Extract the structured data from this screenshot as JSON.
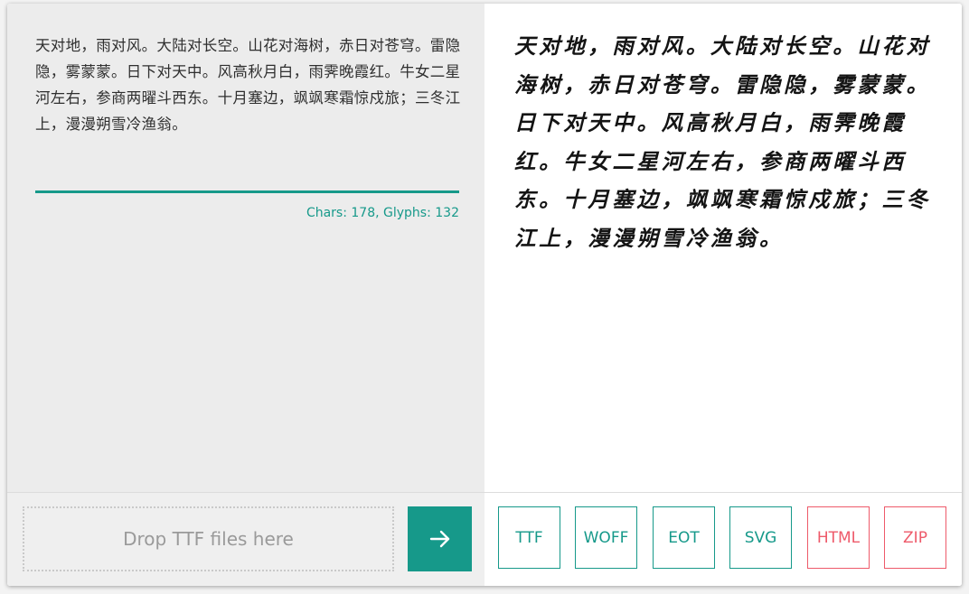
{
  "editor": {
    "source_text": "天对地，雨对风。大陆对长空。山花对海树，赤日对苍穹。雷隐隐，雾蒙蒙。日下对天中。风高秋月白，雨霁晚霞红。牛女二星河左右，参商两曜斗西东。十月塞边，飒飒寒霜惊戍旅；三冬江上，漫漫朔雪冷渔翁。",
    "stats": "Chars: 178, Glyphs: 132"
  },
  "preview": {
    "text": "天对地，雨对风。大陆对长空。山花对海树，赤日对苍穹。雷隐隐，雾蒙蒙。日下对天中。风高秋月白，雨霁晚霞红。牛女二星河左右，参商两曜斗西东。十月塞边，飒飒寒霜惊戍旅；三冬江上，漫漫朔雪冷渔翁。"
  },
  "upload": {
    "drop_label": "Drop TTF files here",
    "go_icon": "arrow-right-icon"
  },
  "formats": [
    {
      "label": "TTF"
    },
    {
      "label": "WOFF"
    },
    {
      "label": "EOT"
    },
    {
      "label": "SVG"
    },
    {
      "label": "HTML"
    },
    {
      "label": "ZIP"
    }
  ],
  "colors": {
    "accent": "#16998a",
    "alt_accent": "#ee5a6a",
    "left_bg": "#ececec"
  }
}
